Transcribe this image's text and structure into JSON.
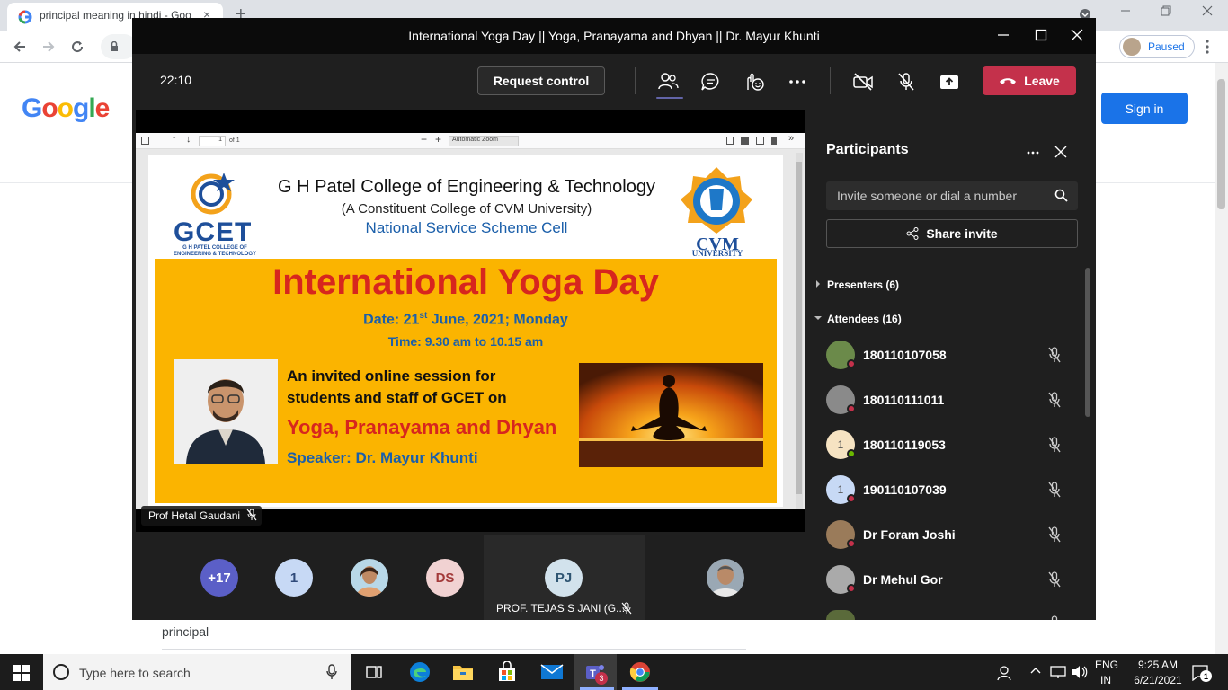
{
  "browser": {
    "tab_title": "principal meaning in hindi - Goo",
    "tab_close": "×",
    "new_tab": "+",
    "profile_status": "Paused",
    "sign_in_label": "Sign in",
    "google_logo": [
      "G",
      "o",
      "o",
      "g",
      "l",
      "e"
    ],
    "google_colors": [
      "#4285f4",
      "#ea4335",
      "#fbbc05",
      "#4285f4",
      "#34a853",
      "#ea4335"
    ],
    "background_result_snippet": "principal"
  },
  "teams": {
    "window_title": "International Yoga Day || Yoga, Pranayama and Dhyan || Dr. Mayur Khunti",
    "call_timer": "22:10",
    "request_control_label": "Request control",
    "leave_label": "Leave",
    "toolbar_icons": [
      "people-icon",
      "chat-icon",
      "raise-hand-icon",
      "more-icon",
      "camera-off-icon",
      "mic-off-icon",
      "share-tray-icon"
    ],
    "presenter_name": "Prof Hetal Gaudani",
    "shared_pdf": {
      "page_indicator": "1",
      "page_total": "of 1",
      "zoom": "Automatic Zoom",
      "poster": {
        "logo_left": "GCET",
        "logo_left_sub": "G H PATEL COLLEGE OF ENGINEERING & TECHNOLOGY",
        "college_name": "G H Patel College of Engineering & Technology",
        "college_sub": "(A Constituent College of CVM University)",
        "cell_name": "National Service Scheme Cell",
        "logo_right": "CVM",
        "logo_right_sub": "UNIVERSITY",
        "event_title": "International Yoga Day",
        "date_prefix": "Date: 21",
        "date_sup": "st",
        "date_suffix": " June, 2021; Monday",
        "time": "Time: 9.30 am to 10.15 am",
        "invite_line1": "An invited online session for",
        "invite_line2": "students and staff of GCET on",
        "session_title": "Yoga, Pranayama and Dhyan",
        "speaker": "Speaker: Dr. Mayur Khunti"
      }
    },
    "gallery": [
      {
        "label": "+17",
        "bg": "#5b5fc7",
        "fg": "#ffffff"
      },
      {
        "label": "1",
        "bg": "#c7d9f5",
        "fg": "#2f4a7a"
      },
      {
        "label": "",
        "bg": "#c98a6a",
        "fg": "#ffffff"
      },
      {
        "label": "DS",
        "bg": "#f1d2d2",
        "fg": "#a33a3a"
      },
      {
        "label": "PJ",
        "bg": "#d2e2ec",
        "fg": "#2f5572"
      },
      {
        "label": "",
        "bg": "#8f8f8f",
        "fg": "#ffffff"
      }
    ],
    "gallery_active_name": "PROF. TEJAS S JANI (G...",
    "panel": {
      "title": "Participants",
      "invite_placeholder": "Invite someone or dial a number",
      "share_invite_label": "Share invite",
      "presenters_label": "Presenters (6)",
      "attendees_label": "Attendees (16)",
      "attendees": [
        {
          "name": "180110107058",
          "initial": "",
          "avatar_bg": "#6b8a4a",
          "status": "#c4314b"
        },
        {
          "name": "180110111011",
          "initial": "",
          "avatar_bg": "#8a8a8a",
          "status": "#c4314b"
        },
        {
          "name": "180110119053",
          "initial": "1",
          "avatar_bg": "#f6e3c2",
          "status": "#6bb700"
        },
        {
          "name": "190110107039",
          "initial": "1",
          "avatar_bg": "#c7d9f5",
          "status": "#c4314b"
        },
        {
          "name": "Dr Foram Joshi",
          "initial": "",
          "avatar_bg": "#9a7b5a",
          "status": "#c4314b"
        },
        {
          "name": "Dr Mehul Gor",
          "initial": "",
          "avatar_bg": "#aaaaaa",
          "status": "#c4314b"
        }
      ]
    }
  },
  "taskbar": {
    "search_placeholder": "Type here to search",
    "language_top": "ENG",
    "language_bottom": "IN",
    "time": "9:25 AM",
    "date": "6/21/2021",
    "teams_badge": "3",
    "notification_count": "1"
  }
}
